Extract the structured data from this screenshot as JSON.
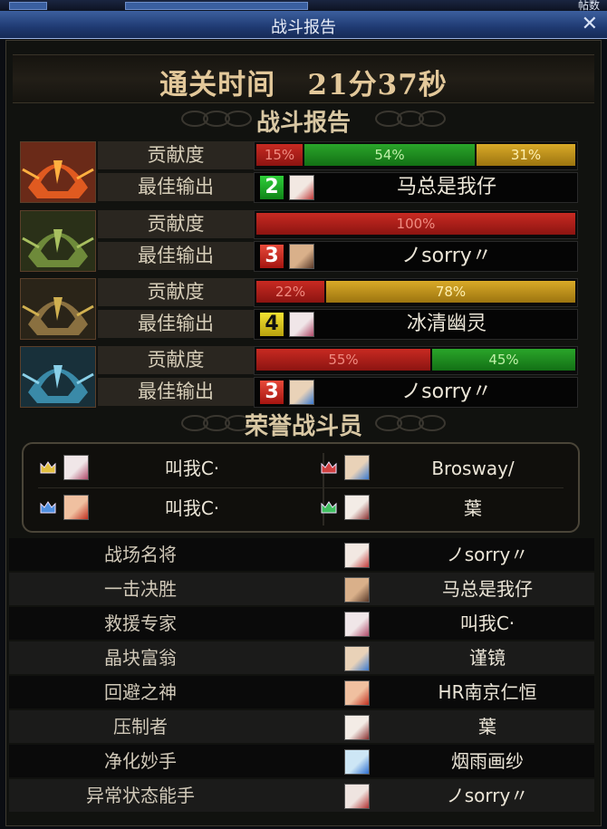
{
  "window": {
    "top_counter_text": "帖数",
    "title": "战斗报告",
    "close_glyph": "✕"
  },
  "clear_time": {
    "label": "通关时间",
    "value": "21分37秒"
  },
  "battle_report": {
    "heading": "战斗报告",
    "contribution_label": "贡献度",
    "best_output_label": "最佳输出",
    "bosses": [
      {
        "icon": "red-flame-helmet-icon",
        "segments": [
          {
            "color": "red",
            "percent": 15,
            "label": "15%"
          },
          {
            "color": "green",
            "percent": 54,
            "label": "54%"
          },
          {
            "color": "gold",
            "percent": 31,
            "label": "31%"
          }
        ],
        "best_number": "2",
        "best_number_color": "green",
        "best_name": "马总是我仔"
      },
      {
        "icon": "green-horned-helmet-icon",
        "segments": [
          {
            "color": "red",
            "percent": 100,
            "label": "100%"
          }
        ],
        "best_number": "3",
        "best_number_color": "red",
        "best_name": "ノsorry〃"
      },
      {
        "icon": "gold-dark-helmet-icon",
        "segments": [
          {
            "color": "red",
            "percent": 22,
            "label": "22%"
          },
          {
            "color": "gold",
            "percent": 78,
            "label": "78%"
          }
        ],
        "best_number": "4",
        "best_number_color": "yellow",
        "best_name": "冰清幽灵"
      },
      {
        "icon": "blue-ice-helmet-icon",
        "segments": [
          {
            "color": "red",
            "percent": 55,
            "label": "55%"
          },
          {
            "color": "green",
            "percent": 45,
            "label": "45%"
          }
        ],
        "best_number": "3",
        "best_number_color": "red",
        "best_name": "ノsorry〃"
      }
    ]
  },
  "honor": {
    "heading": "荣誉战斗员",
    "members": [
      {
        "crown": "gold-crown-icon",
        "name": "叫我C·"
      },
      {
        "crown": "red-crown-icon",
        "name": "Brosway/"
      },
      {
        "crown": "blue-crown-icon",
        "name": "叫我C·"
      },
      {
        "crown": "green-crown-icon",
        "name": "葉"
      }
    ]
  },
  "awards": [
    {
      "title": "战场名将",
      "name": "ノsorry〃"
    },
    {
      "title": "一击决胜",
      "name": "马总是我仔"
    },
    {
      "title": "救援专家",
      "name": "叫我C·"
    },
    {
      "title": "晶块富翁",
      "name": "谨镜"
    },
    {
      "title": "回避之神",
      "name": "HR南京仁恒"
    },
    {
      "title": "压制者",
      "name": "葉"
    },
    {
      "title": "净化妙手",
      "name": "烟雨画纱"
    },
    {
      "title": "异常状态能手",
      "name": "ノsorry〃"
    }
  ],
  "colors": {
    "red": "#c82a22",
    "green": "#2aa52a",
    "gold": "#d9aa28",
    "title_bar": "#2b4a88",
    "heading_text": "#d8c7a3"
  }
}
